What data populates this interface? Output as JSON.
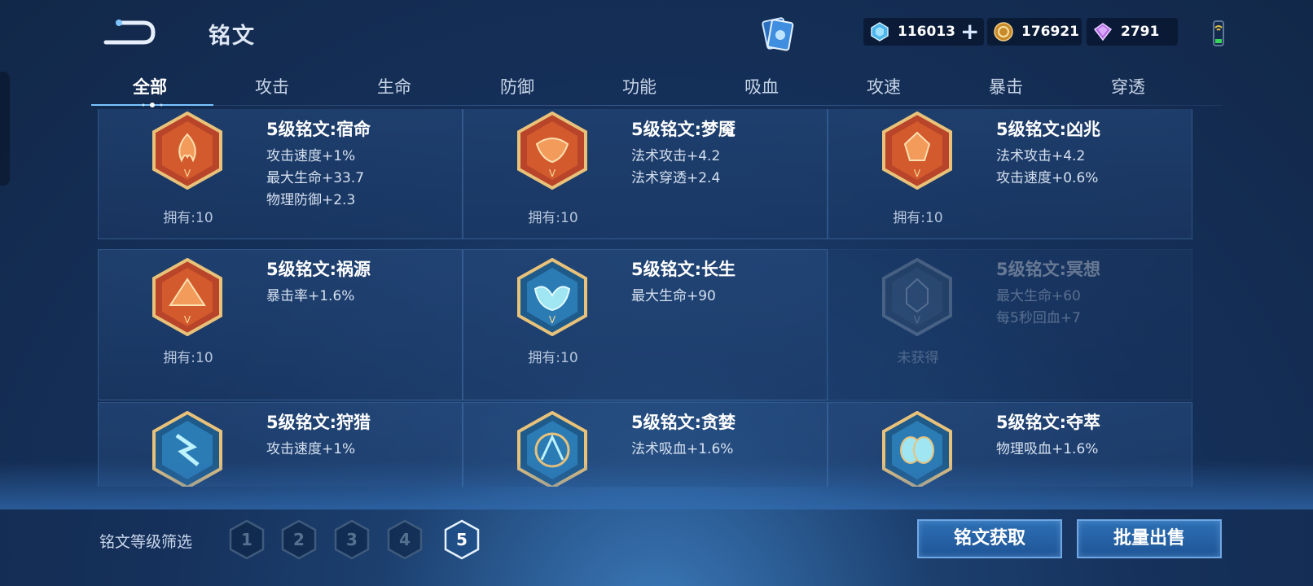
{
  "header": {
    "title": "铭文",
    "currencies": [
      {
        "name": "ticket",
        "value": "116013"
      },
      {
        "name": "gold",
        "value": "176921"
      },
      {
        "name": "diamond",
        "value": "2791"
      }
    ]
  },
  "tabs": [
    "全部",
    "攻击",
    "生命",
    "防御",
    "功能",
    "吸血",
    "攻速",
    "暴击",
    "穿透"
  ],
  "active_tab": 0,
  "runes": [
    {
      "name": "5级铭文:宿命",
      "stats": [
        "攻击速度+1%",
        "最大生命+33.7",
        "物理防御+2.3"
      ],
      "owned": "拥有:10",
      "color": "#d0521f"
    },
    {
      "name": "5级铭文:梦魇",
      "stats": [
        "法术攻击+4.2",
        "法术穿透+2.4"
      ],
      "owned": "拥有:10",
      "color": "#d0521f"
    },
    {
      "name": "5级铭文:凶兆",
      "stats": [
        "法术攻击+4.2",
        "攻击速度+0.6%"
      ],
      "owned": "拥有:10",
      "color": "#d0521f"
    },
    {
      "name": "5级铭文:祸源",
      "stats": [
        "暴击率+1.6%"
      ],
      "owned": "拥有:10",
      "color": "#d0521f"
    },
    {
      "name": "5级铭文:长生",
      "stats": [
        "最大生命+90"
      ],
      "owned": "拥有:10",
      "color": "#2e86c8"
    },
    {
      "name": "5级铭文:冥想",
      "stats": [
        "最大生命+60",
        "每5秒回血+7"
      ],
      "owned": "未获得",
      "color": "#5a7aa0"
    },
    {
      "name": "5级铭文:狩猎",
      "stats": [
        "攻击速度+1%"
      ],
      "owned": "",
      "color": "#2e86c8"
    },
    {
      "name": "5级铭文:贪婪",
      "stats": [
        "法术吸血+1.6%"
      ],
      "owned": "",
      "color": "#2e86c8"
    },
    {
      "name": "5级铭文:夺萃",
      "stats": [
        "物理吸血+1.6%"
      ],
      "owned": "",
      "color": "#2e86c8"
    }
  ],
  "footer": {
    "filter_label": "铭文等级筛选",
    "levels": [
      "1",
      "2",
      "3",
      "4",
      "5"
    ],
    "active_level": "5",
    "obtain_button": "铭文获取",
    "sell_button": "批量出售"
  }
}
